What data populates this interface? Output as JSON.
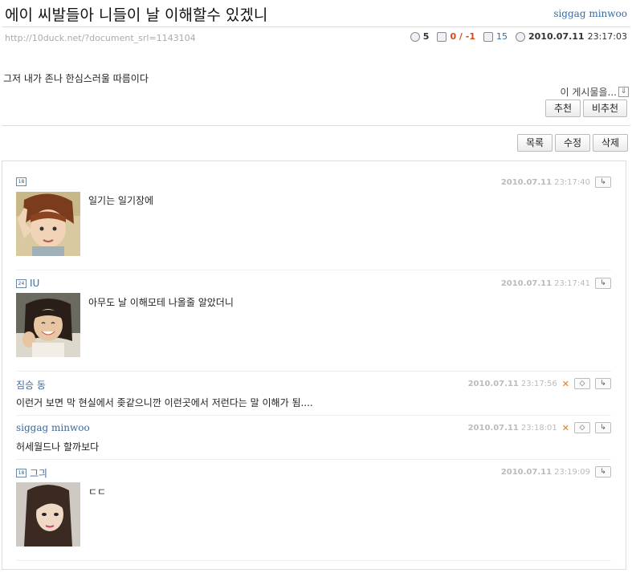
{
  "post": {
    "title": "에이 씨발들아 니들이 날 이해할수 있겠니",
    "author": "siggag minwoo",
    "url": "http://10duck.net/?document_srl=1143104",
    "comment_count": "5",
    "votes": "0 / -1",
    "views": "15",
    "date": "2010.07.11",
    "time": "23:17:03",
    "body": "그저 내가 존나 한심스러울 따름이다",
    "menu_label": "이 게시물을...",
    "recommend_label": "추천",
    "unrecommend_label": "비추천"
  },
  "actions": {
    "list_label": "목록",
    "edit_label": "수정",
    "delete_label": "삭제"
  },
  "comments": [
    {
      "name": "",
      "badge": "18",
      "date": "2010.07.11",
      "time": "23:17:40",
      "text": "일기는 일기장에",
      "avatar": "girl-peace-sign-photo"
    },
    {
      "name": "IU",
      "badge": "24",
      "date": "2010.07.11",
      "time": "23:17:41",
      "text": "아무도 날 이해모테 나올줄 알았더니",
      "avatar": "smiling-girl-photo"
    },
    {
      "name": "짐승 동",
      "date": "2010.07.11",
      "time": "23:17:56",
      "text": "이런거 보면 막 현실에서 좆같으니깐 이런곳에서 저런다는 말 이해가 됨....",
      "avatar": ""
    },
    {
      "name": "siggag minwoo",
      "date": "2010.07.11",
      "time": "23:18:01",
      "text": "허세월드나 할까보다",
      "avatar": ""
    },
    {
      "name": "그긔",
      "badge": "18",
      "date": "2010.07.11",
      "time": "23:19:09",
      "text": "ㄷㄷ",
      "avatar": "long-hair-girl-photo"
    }
  ],
  "icons": {
    "reply": "reply-arrow-icon",
    "edit": "eraser-edit-icon",
    "delete": "x-delete-icon"
  },
  "colors": {
    "link": "#3a6a9e",
    "vote_red": "#d24b1f",
    "delete_orange": "#e07a1f"
  }
}
